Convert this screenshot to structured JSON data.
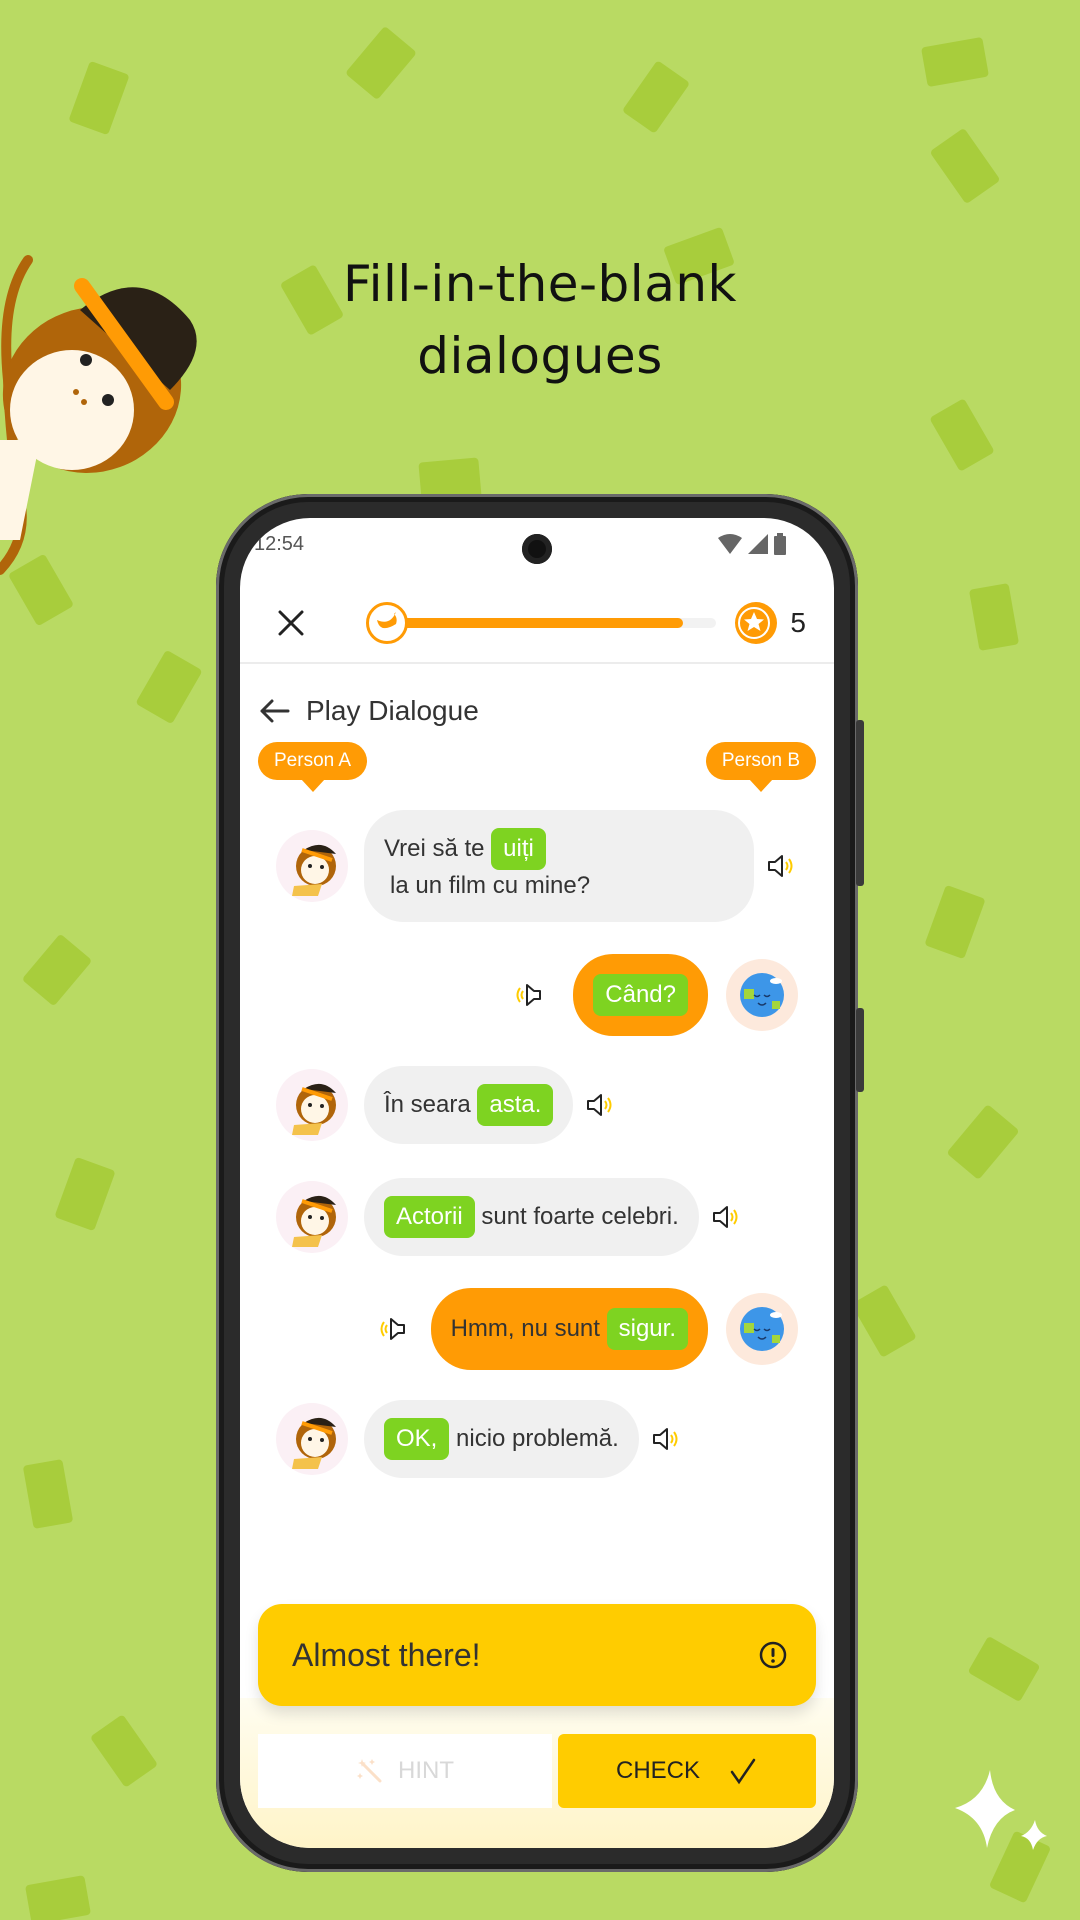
{
  "hero": {
    "title_line1": "Fill-in-the-blank",
    "title_line2": "dialogues"
  },
  "status_bar": {
    "time": "12:54",
    "icons": [
      "wifi-icon",
      "signal-icon",
      "battery-icon"
    ]
  },
  "top_bar": {
    "close_icon": "close-icon",
    "progress_fraction": 0.9,
    "progress_start_icon": "banana-icon",
    "coin_icon": "star-coin-icon",
    "coin_count": "5"
  },
  "header": {
    "back_icon": "arrow-left-icon",
    "title": "Play Dialogue"
  },
  "speakers": {
    "person_a": "Person A",
    "person_b": "Person B"
  },
  "messages": [
    {
      "speaker": "A",
      "avatar": "monkey-avatar",
      "before": "Vrei să te",
      "blank": "uiți",
      "after": "la un film cu mine?"
    },
    {
      "speaker": "B",
      "avatar": "earth-avatar",
      "before": "",
      "blank": "Când?",
      "after": ""
    },
    {
      "speaker": "A",
      "avatar": "monkey-avatar",
      "before": "În seara",
      "blank": "asta.",
      "after": ""
    },
    {
      "speaker": "A",
      "avatar": "monkey-avatar",
      "before": "",
      "blank": "Actorii",
      "after": "sunt foarte celebri."
    },
    {
      "speaker": "B",
      "avatar": "earth-avatar",
      "before": "Hmm, nu sunt",
      "blank": "sigur.",
      "after": ""
    },
    {
      "speaker": "A",
      "avatar": "monkey-avatar",
      "before": "",
      "blank": "OK,",
      "after": "nicio problemă."
    }
  ],
  "feedback": {
    "text": "Almost there!",
    "icon": "exclamation-circle-icon"
  },
  "actions": {
    "hint_label": "HINT",
    "hint_icon": "magic-wand-icon",
    "check_label": "CHECK",
    "check_icon": "checkmark-icon"
  },
  "colors": {
    "background": "#b9da63",
    "accent_orange": "#ff9b05",
    "blank_green": "#7ed321",
    "feedback_yellow": "#ffcc00",
    "bubble_gray": "#f0f0f0"
  }
}
